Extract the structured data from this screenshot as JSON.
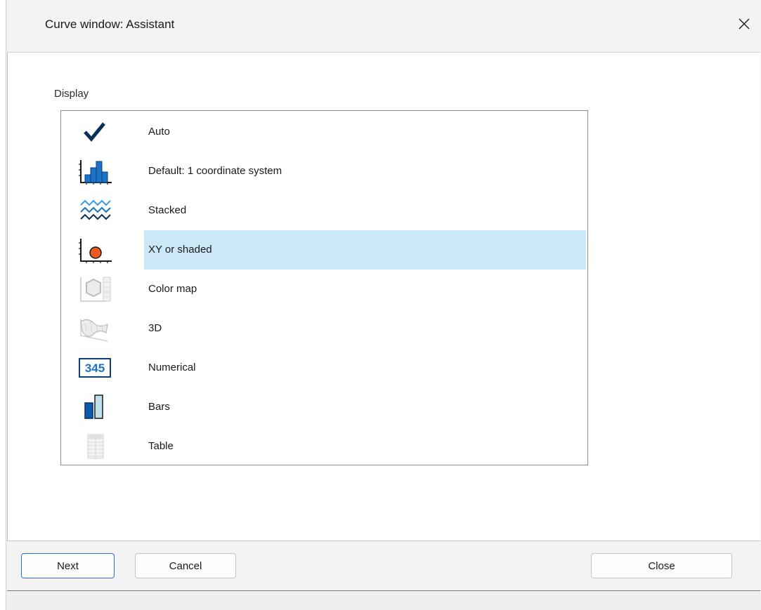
{
  "window": {
    "title": "Curve window: Assistant",
    "close_icon": "close-icon"
  },
  "display": {
    "label": "Display",
    "selected_index": 3,
    "items": [
      {
        "label": "Auto",
        "icon": "checkmark-icon"
      },
      {
        "label": "Default: 1 coordinate system",
        "icon": "histogram-icon"
      },
      {
        "label": "Stacked",
        "icon": "stacked-waves-icon"
      },
      {
        "label": "XY or shaded",
        "icon": "xy-point-icon"
      },
      {
        "label": "Color map",
        "icon": "color-map-icon"
      },
      {
        "label": "3D",
        "icon": "3d-surface-icon"
      },
      {
        "label": "Numerical",
        "icon": "numerical-icon",
        "icon_text": "345"
      },
      {
        "label": "Bars",
        "icon": "bars-icon"
      },
      {
        "label": "Table",
        "icon": "table-icon"
      }
    ]
  },
  "buttons": {
    "next": "Next",
    "cancel": "Cancel",
    "close": "Close"
  },
  "colors": {
    "accent": "#0a5bab",
    "selection": "#cce8f8",
    "marker": "#f05a1e"
  }
}
